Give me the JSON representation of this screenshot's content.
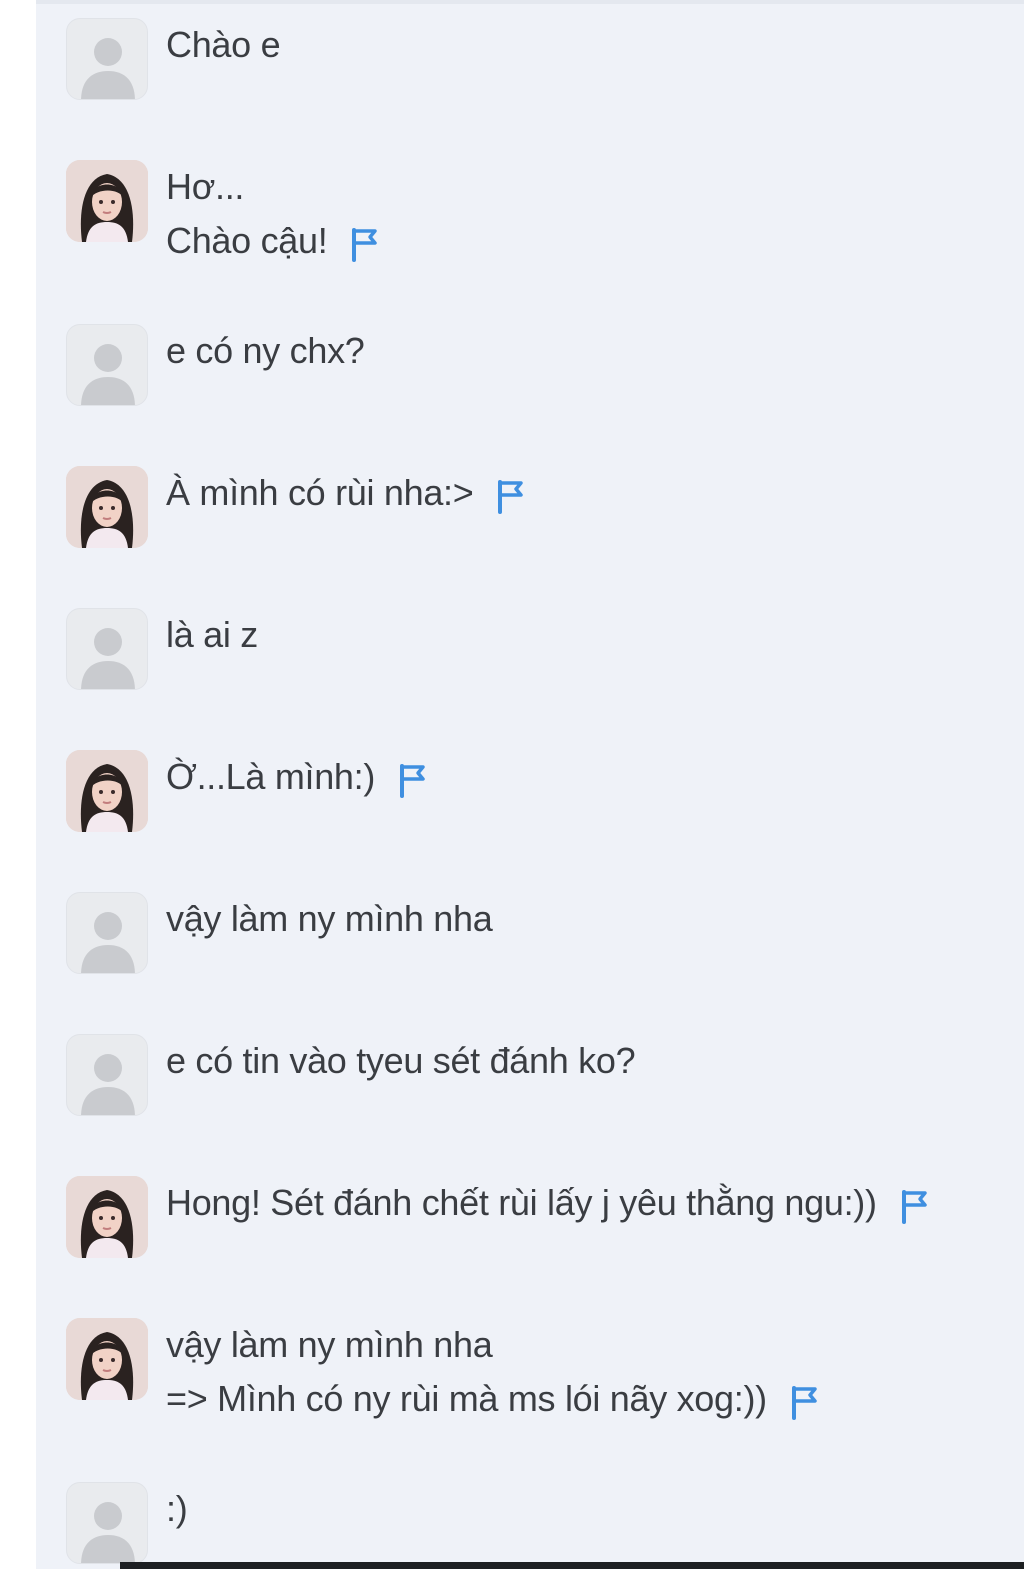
{
  "colors": {
    "panel_bg": "#eff2f8",
    "text": "#3a3d42",
    "flag": "#3f8fe0",
    "guest_avatar": "#c9cbcf"
  },
  "icons": {
    "guest_avatar": "person-silhouette-icon",
    "girl_avatar": "profile-photo-avatar",
    "report": "flag-icon"
  },
  "messages": [
    {
      "sender": "guest",
      "lines": [
        "Chào e"
      ]
    },
    {
      "sender": "girl",
      "lines": [
        "Hơ...",
        "Chào cậu!"
      ],
      "flag": true
    },
    {
      "sender": "guest",
      "lines": [
        "e có ny chx?"
      ]
    },
    {
      "sender": "girl",
      "lines": [
        "À mình có rùi nha:>"
      ],
      "flag": true
    },
    {
      "sender": "guest",
      "lines": [
        "là ai z"
      ]
    },
    {
      "sender": "girl",
      "lines": [
        "Ờ...Là mình:)"
      ],
      "flag": true
    },
    {
      "sender": "guest",
      "lines": [
        "vậy làm ny mình nha"
      ]
    },
    {
      "sender": "guest",
      "lines": [
        "e có tin vào tyeu sét đánh ko?"
      ]
    },
    {
      "sender": "girl",
      "lines": [
        "Hong! Sét đánh chết rùi lấy j yêu thằng ngu:))"
      ],
      "flag": true
    },
    {
      "sender": "girl",
      "lines": [
        "vậy làm ny mình nha",
        "=> Mình có ny rùi mà ms lói nãy xog:))"
      ],
      "flag": true
    },
    {
      "sender": "guest",
      "lines": [
        ":)"
      ]
    }
  ]
}
